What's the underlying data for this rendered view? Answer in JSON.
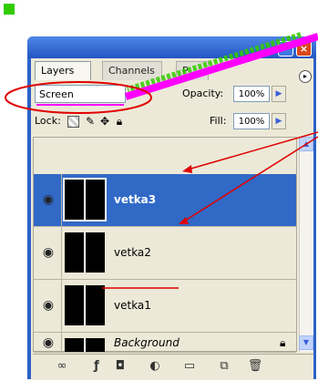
{
  "tabs": [
    {
      "label": "Layers"
    },
    {
      "label": "Channels"
    },
    {
      "label": "P"
    }
  ],
  "blend_mode": {
    "value": "Screen"
  },
  "opacity": {
    "label": "Opacity:",
    "value": "100%"
  },
  "lock": {
    "label": "Lock:"
  },
  "fill": {
    "label": "Fill:",
    "value": "100%"
  },
  "layers": [
    {
      "name": "vetka3",
      "selected": true
    },
    {
      "name": "vetka2",
      "selected": false
    },
    {
      "name": "vetka1",
      "selected": false
    },
    {
      "name": "Background",
      "selected": false,
      "locked": true
    }
  ],
  "icons": {
    "eye": "eye-icon",
    "lock_transparent": "lock-transparent-icon",
    "lock_image": "brush-icon",
    "lock_position": "move-icon",
    "lock_all": "padlock-icon"
  },
  "colors": {
    "selection": "#3169c6",
    "annotation_magenta": "#ff00ff",
    "annotation_red": "#e00000",
    "annotation_green": "#33cc00"
  }
}
